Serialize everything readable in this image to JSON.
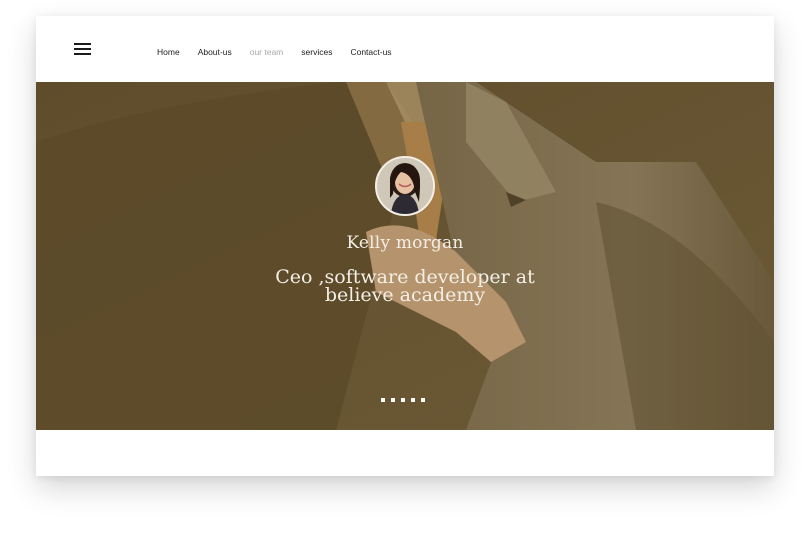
{
  "nav": {
    "menu_icon": "hamburger-menu-icon",
    "links": [
      {
        "label": "Home",
        "active": false
      },
      {
        "label": "About-us",
        "active": false
      },
      {
        "label": "our team",
        "active": true
      },
      {
        "label": "services",
        "active": false
      },
      {
        "label": "Contact-us",
        "active": false
      }
    ]
  },
  "slide": {
    "name": "Kelly morgan",
    "role": "Ceo ,software developer  at believe academy",
    "dots_count": 5,
    "active_dot": 0
  },
  "colors": {
    "overlay": "#675532",
    "active_link": "#a9a9a9",
    "text_light": "#f4efe6"
  }
}
